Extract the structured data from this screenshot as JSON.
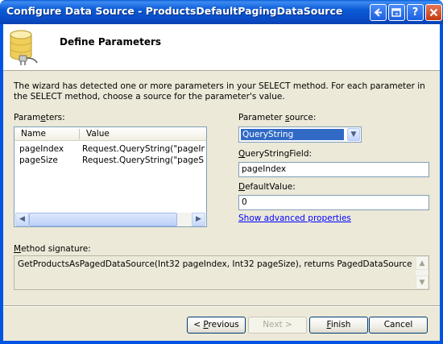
{
  "window": {
    "title": "Configure Data Source - ProductsDefaultPagingDataSource"
  },
  "header": {
    "title": "Define Parameters"
  },
  "description": "The wizard has detected one or more parameters in your SELECT method. For each parameter in the SELECT method, choose a source for the parameter's value.",
  "parameters": {
    "label_pre": "Param",
    "label_key": "e",
    "label_post": "ters:",
    "columns": [
      "Name",
      "Value"
    ],
    "rows": [
      {
        "name": "pageIndex",
        "value": "Request.QueryString(\"pageIndex\")"
      },
      {
        "name": "pageSize",
        "value": "Request.QueryString(\"pageSize\")"
      }
    ]
  },
  "source": {
    "label_pre": "Parameter ",
    "label_key": "s",
    "label_post": "ource:",
    "selected": "QueryString"
  },
  "querystring_field": {
    "label_key": "Q",
    "label_post": "ueryStringField:",
    "value": "pageIndex"
  },
  "default_value": {
    "label_key": "D",
    "label_post": "efaultValue:",
    "value": "0"
  },
  "advanced_link": "Show advanced properties",
  "signature": {
    "label_key": "M",
    "label_post": "ethod signature:",
    "text": "GetProductsAsPagedDataSource(Int32 pageIndex, Int32 pageSize), returns PagedDataSource"
  },
  "buttons": {
    "previous": {
      "pre": "< ",
      "key": "P",
      "post": "revious"
    },
    "next": "Next >",
    "finish": {
      "key": "F",
      "post": "inish"
    },
    "cancel": "Cancel"
  },
  "icons": {
    "db": "database-plug-icon",
    "help": "help-icon",
    "close": "close-icon"
  }
}
